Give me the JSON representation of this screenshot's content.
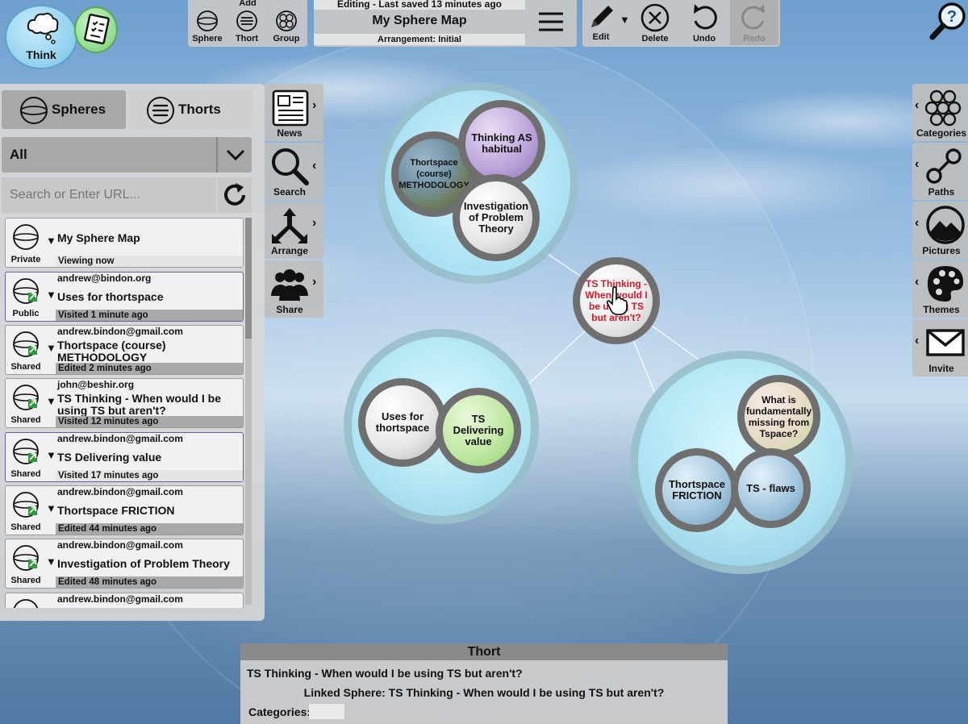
{
  "top": {
    "think_label": "Think",
    "add": {
      "header": "Add",
      "items": [
        {
          "label": "Sphere",
          "icon": "sphere-icon"
        },
        {
          "label": "Thort",
          "icon": "thort-icon"
        },
        {
          "label": "Group",
          "icon": "group-icon"
        }
      ]
    },
    "status": "Editing - Last saved 13 minutes ago",
    "map_title": "My Sphere Map",
    "arrangement": "Arrangement: Initial",
    "tools": {
      "edit": "Edit",
      "delete": "Delete",
      "undo": "Undo",
      "redo": "Redo"
    }
  },
  "left_panel": {
    "tabs": [
      {
        "label": "Spheres",
        "active": true
      },
      {
        "label": "Thorts",
        "active": false
      }
    ],
    "filter": "All",
    "search_placeholder": "Search or Enter URL...",
    "items": [
      {
        "badge": "Private",
        "owner": "",
        "name": "My Sphere Map",
        "time": "Viewing now",
        "selected": false
      },
      {
        "badge": "Public",
        "owner": "andrew@bindon.org",
        "name": "Uses for thortspace",
        "time": "Visited 1 minute ago",
        "selected": true
      },
      {
        "badge": "Shared",
        "owner": "andrew.bindon@gmail.com",
        "name": "Thortspace (course) METHODOLOGY",
        "time": "Edited 2 minutes ago",
        "selected": false
      },
      {
        "badge": "Shared",
        "owner": "john@beshir.org",
        "name": "TS Thinking - When would I be using TS but aren't?",
        "time": "Visited 12 minutes ago",
        "selected": false
      },
      {
        "badge": "Shared",
        "owner": "andrew.bindon@gmail.com",
        "name": "TS Delivering value",
        "time": "Visited 17 minutes ago",
        "selected": true
      },
      {
        "badge": "Shared",
        "owner": "andrew.bindon@gmail.com",
        "name": "Thortspace FRICTION",
        "time": "Edited 44 minutes ago",
        "selected": false
      },
      {
        "badge": "Shared",
        "owner": "andrew.bindon@gmail.com",
        "name": "Investigation of Problem Theory",
        "time": "Edited 48 minutes ago",
        "selected": false
      },
      {
        "badge": "",
        "owner": "andrew.bindon@gmail.com",
        "name": "",
        "time": "",
        "selected": false
      }
    ]
  },
  "side_left": [
    {
      "label": "News",
      "icon": "newspaper-icon"
    },
    {
      "label": "Search",
      "icon": "search-icon"
    },
    {
      "label": "Arrange",
      "icon": "arrange-icon"
    },
    {
      "label": "Share",
      "icon": "people-icon"
    }
  ],
  "side_right": [
    {
      "label": "Categories",
      "icon": "categories-icon"
    },
    {
      "label": "Paths",
      "icon": "paths-icon"
    },
    {
      "label": "Pictures",
      "icon": "pictures-icon"
    },
    {
      "label": "Themes",
      "icon": "palette-icon"
    },
    {
      "label": "Invite",
      "icon": "envelope-icon"
    }
  ],
  "map": {
    "nodes": [
      {
        "id": "thinking-habitual",
        "text": "Thinking AS habitual"
      },
      {
        "id": "methodology",
        "text": "Thortspace (course) METHODOLOGY"
      },
      {
        "id": "problem-theory",
        "text": "Investigation of Problem Theory"
      },
      {
        "id": "ts-thinking",
        "text": "TS Thinking - When would I be using TS but aren't?"
      },
      {
        "id": "uses-thortspace",
        "text": "Uses for thortspace"
      },
      {
        "id": "delivering-value",
        "text": "TS Delivering value"
      },
      {
        "id": "fundamentally-missing",
        "text": "What is fundamentally missing from Tspace?"
      },
      {
        "id": "friction",
        "text": "Thortspace FRICTION"
      },
      {
        "id": "flaws",
        "text": "TS - flaws"
      }
    ]
  },
  "thort_panel": {
    "header": "Thort",
    "title": "TS Thinking - When would I be using TS but aren't?",
    "linked": "Linked Sphere: TS Thinking - When would I be using TS but aren't?",
    "categories_label": "Categories:"
  },
  "colors": {
    "accent_red": "#d11a2a",
    "sphere_cyan": "#b8ecf6"
  }
}
